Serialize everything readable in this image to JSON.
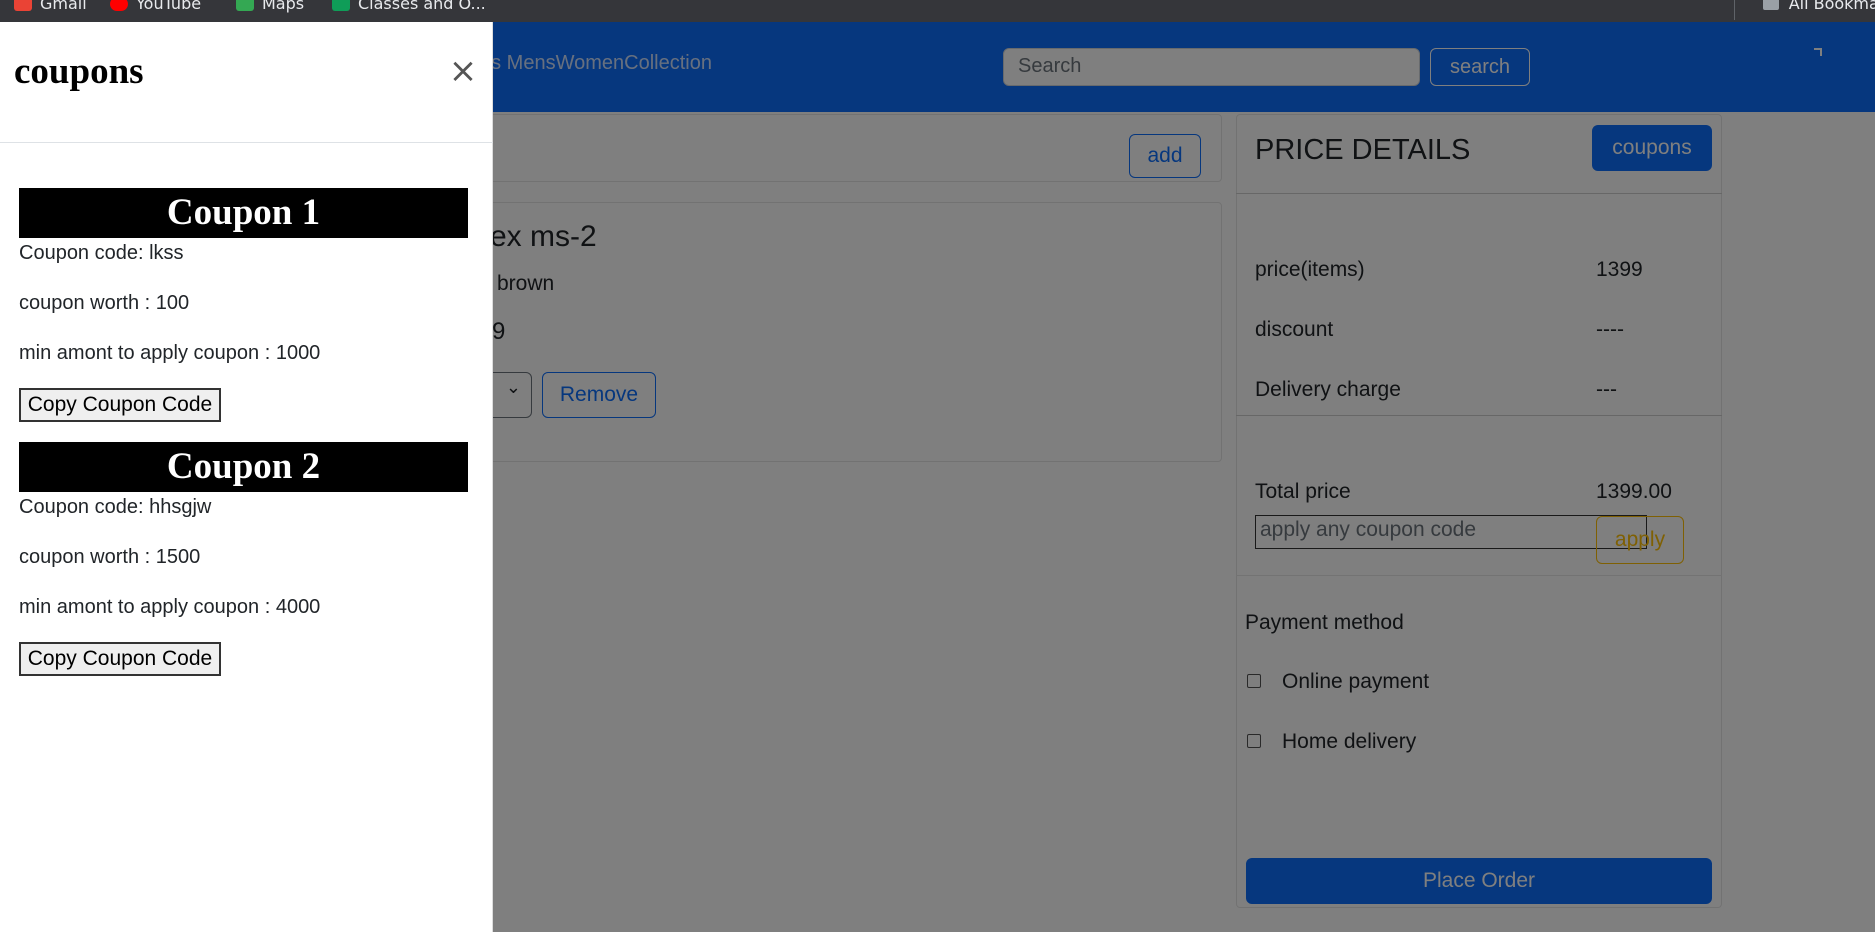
{
  "bookmarks": [
    {
      "label": "Gmail",
      "color": "#ea4335"
    },
    {
      "label": "YouTube",
      "color": "#ff0000"
    },
    {
      "label": "Maps",
      "color": "#34a853"
    },
    {
      "label": "Classes and O...",
      "color": "#0f9d58"
    }
  ],
  "bookmarks_right": "All Bookmarks",
  "navbar": {
    "links": "ds MensWomenCollection",
    "search_placeholder": "Search",
    "search_button": "search"
  },
  "cart": {
    "add_label": "add",
    "item_name": "ex ms-2",
    "item_color": "brown",
    "item_price": "9",
    "remove_label": "Remove"
  },
  "price_details": {
    "title": "PRICE DETAILS",
    "coupons_button": "coupons",
    "rows": [
      {
        "label": "price(items)",
        "value": "1399"
      },
      {
        "label": "discount",
        "value": "----"
      },
      {
        "label": "Delivery charge",
        "value": "---"
      }
    ],
    "total_label": "Total price",
    "total_value": "1399.00",
    "coupon_placeholder": "apply any coupon code",
    "apply_label": "apply",
    "payment_title": "Payment method",
    "payment_options": [
      "Online payment",
      "Home delivery"
    ],
    "place_order": "Place Order"
  },
  "offcanvas": {
    "title": "coupons",
    "close_icon": "×",
    "coupons": [
      {
        "heading": "Coupon 1",
        "code_line": "Coupon code: lkss",
        "worth_line": "coupon worth : 100",
        "min_line": "min amont to apply coupon : 1000",
        "copy_label": "Copy Coupon Code"
      },
      {
        "heading": "Coupon 2",
        "code_line": "Coupon code: hhsgjw",
        "worth_line": "coupon worth : 1500",
        "min_line": "min amont to apply coupon : 4000",
        "copy_label": "Copy Coupon Code"
      }
    ]
  },
  "colors": {
    "primary": "#0d6efd",
    "warning": "#ffc107",
    "overlay": "rgba(0,0,0,0.5)"
  }
}
